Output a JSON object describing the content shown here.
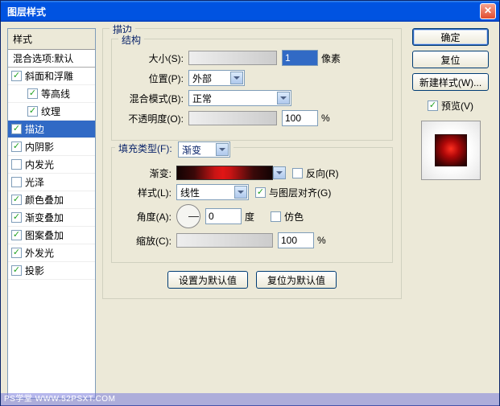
{
  "title": "图层样式",
  "left": {
    "header": "样式",
    "blend_defaults": "混合选项:默认",
    "items": [
      {
        "label": "斜面和浮雕",
        "checked": true
      },
      {
        "label": "等高线",
        "checked": true,
        "sub": true
      },
      {
        "label": "纹理",
        "checked": true,
        "sub": true
      },
      {
        "label": "描边",
        "checked": true,
        "selected": true
      },
      {
        "label": "内阴影",
        "checked": true
      },
      {
        "label": "内发光",
        "checked": false
      },
      {
        "label": "光泽",
        "checked": false
      },
      {
        "label": "颜色叠加",
        "checked": true
      },
      {
        "label": "渐变叠加",
        "checked": true
      },
      {
        "label": "图案叠加",
        "checked": true
      },
      {
        "label": "外发光",
        "checked": true
      },
      {
        "label": "投影",
        "checked": true
      }
    ]
  },
  "main": {
    "group_title": "描边",
    "struct_title": "结构",
    "size_label": "大小(S):",
    "size_value": "1",
    "size_unit": "像素",
    "position_label": "位置(P):",
    "position_value": "外部",
    "blendmode_label": "混合模式(B):",
    "blendmode_value": "正常",
    "opacity_label": "不透明度(O):",
    "opacity_value": "100",
    "opacity_unit": "%",
    "filltype_label": "填充类型(F):",
    "filltype_value": "渐变",
    "gradient_label": "渐变:",
    "reverse_label": "反向(R)",
    "style_label": "样式(L):",
    "style_value": "线性",
    "align_label": "与图层对齐(G)",
    "angle_label": "角度(A):",
    "angle_value": "0",
    "angle_unit": "度",
    "dither_label": "仿色",
    "scale_label": "缩放(C):",
    "scale_value": "100",
    "scale_unit": "%",
    "set_default": "设置为默认值",
    "reset_default": "复位为默认值"
  },
  "right": {
    "ok": "确定",
    "cancel": "复位",
    "new_style": "新建样式(W)...",
    "preview_label": "预览(V)"
  },
  "watermark": "PS学堂  WWW.52PSXT.COM"
}
